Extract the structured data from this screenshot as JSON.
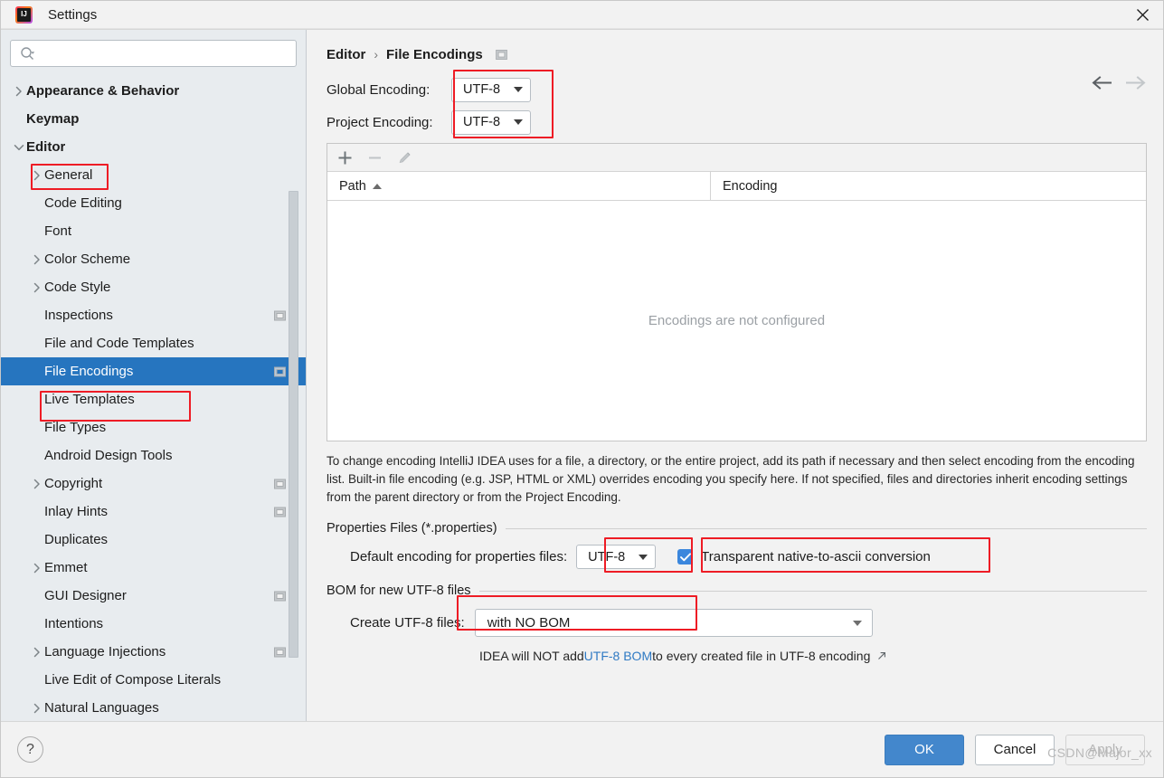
{
  "window": {
    "title": "Settings",
    "logo_text": "IJ",
    "close_label": "×"
  },
  "sidebar": {
    "search": {
      "value": "",
      "placeholder": ""
    },
    "items": [
      {
        "label": "Appearance & Behavior",
        "level": 0,
        "arrow": "right",
        "bold": true,
        "selected": false,
        "trailing": false
      },
      {
        "label": "Keymap",
        "level": 0,
        "arrow": "none",
        "bold": true,
        "selected": false,
        "trailing": false
      },
      {
        "label": "Editor",
        "level": 0,
        "arrow": "down",
        "bold": true,
        "selected": false,
        "trailing": false
      },
      {
        "label": "General",
        "level": 1,
        "arrow": "right",
        "bold": false,
        "selected": false,
        "trailing": false
      },
      {
        "label": "Code Editing",
        "level": 1,
        "arrow": "none",
        "bold": false,
        "selected": false,
        "trailing": false
      },
      {
        "label": "Font",
        "level": 1,
        "arrow": "none",
        "bold": false,
        "selected": false,
        "trailing": false
      },
      {
        "label": "Color Scheme",
        "level": 1,
        "arrow": "right",
        "bold": false,
        "selected": false,
        "trailing": false
      },
      {
        "label": "Code Style",
        "level": 1,
        "arrow": "right",
        "bold": false,
        "selected": false,
        "trailing": false
      },
      {
        "label": "Inspections",
        "level": 1,
        "arrow": "none",
        "bold": false,
        "selected": false,
        "trailing": true
      },
      {
        "label": "File and Code Templates",
        "level": 1,
        "arrow": "none",
        "bold": false,
        "selected": false,
        "trailing": false
      },
      {
        "label": "File Encodings",
        "level": 1,
        "arrow": "none",
        "bold": false,
        "selected": true,
        "trailing": true
      },
      {
        "label": "Live Templates",
        "level": 1,
        "arrow": "none",
        "bold": false,
        "selected": false,
        "trailing": false
      },
      {
        "label": "File Types",
        "level": 1,
        "arrow": "none",
        "bold": false,
        "selected": false,
        "trailing": false
      },
      {
        "label": "Android Design Tools",
        "level": 1,
        "arrow": "none",
        "bold": false,
        "selected": false,
        "trailing": false
      },
      {
        "label": "Copyright",
        "level": 1,
        "arrow": "right",
        "bold": false,
        "selected": false,
        "trailing": true
      },
      {
        "label": "Inlay Hints",
        "level": 1,
        "arrow": "none",
        "bold": false,
        "selected": false,
        "trailing": true
      },
      {
        "label": "Duplicates",
        "level": 1,
        "arrow": "none",
        "bold": false,
        "selected": false,
        "trailing": false
      },
      {
        "label": "Emmet",
        "level": 1,
        "arrow": "right",
        "bold": false,
        "selected": false,
        "trailing": false
      },
      {
        "label": "GUI Designer",
        "level": 1,
        "arrow": "none",
        "bold": false,
        "selected": false,
        "trailing": true
      },
      {
        "label": "Intentions",
        "level": 1,
        "arrow": "none",
        "bold": false,
        "selected": false,
        "trailing": false
      },
      {
        "label": "Language Injections",
        "level": 1,
        "arrow": "right",
        "bold": false,
        "selected": false,
        "trailing": true
      },
      {
        "label": "Live Edit of Compose Literals",
        "level": 1,
        "arrow": "none",
        "bold": false,
        "selected": false,
        "trailing": false
      },
      {
        "label": "Natural Languages",
        "level": 1,
        "arrow": "right",
        "bold": false,
        "selected": false,
        "trailing": false
      }
    ]
  },
  "main": {
    "breadcrumb": {
      "parent": "Editor",
      "separator": "›",
      "current": "File Encodings"
    },
    "global_encoding": {
      "label": "Global Encoding:",
      "value": "UTF-8"
    },
    "project_encoding": {
      "label": "Project Encoding:",
      "value": "UTF-8"
    },
    "table": {
      "toolbar": {
        "add": "+",
        "remove": "−",
        "edit": "edit-pencil-icon"
      },
      "columns": [
        "Path",
        "Encoding"
      ],
      "sort_column": "Path",
      "sort_direction": "asc",
      "rows": [],
      "empty_message": "Encodings are not configured"
    },
    "description": "To change encoding IntelliJ IDEA uses for a file, a directory, or the entire project, add its path if necessary and then select encoding from the encoding list. Built-in file encoding (e.g. JSP, HTML or XML) overrides encoding you specify here. If not specified, files and directories inherit encoding settings from the parent directory or from the Project Encoding.",
    "properties_group": {
      "title": "Properties Files (*.properties)",
      "default_encoding_label": "Default encoding for properties files:",
      "default_encoding_value": "UTF-8",
      "transparent_label": "Transparent native-to-ascii conversion",
      "transparent_checked": true
    },
    "bom_group": {
      "title": "BOM for new UTF-8 files",
      "create_label": "Create UTF-8 files:",
      "create_value": "with NO BOM",
      "note_prefix": "IDEA will NOT add ",
      "note_link": "UTF-8 BOM",
      "note_suffix": " to every created file in UTF-8 encoding"
    }
  },
  "footer": {
    "help": "?",
    "ok": "OK",
    "cancel": "Cancel",
    "apply": "Apply",
    "apply_disabled": true,
    "watermark": "CSDN@Major_xx"
  },
  "colors": {
    "selection": "#2675bf",
    "annotation": "#ee1c25",
    "primary_button": "#4387cc",
    "link": "#2f7ac4",
    "checkbox": "#3b87dd"
  }
}
